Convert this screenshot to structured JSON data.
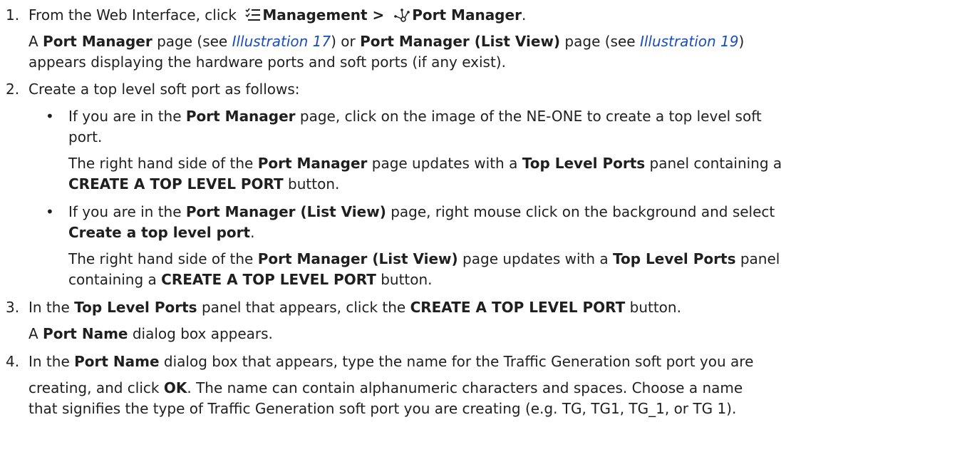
{
  "step1": {
    "num": "1.",
    "intro": "From the Web Interface, click ",
    "menu1": "Management > ",
    "menu2": "Port Manager",
    "end": ".",
    "result": {
      "a": "A ",
      "pm": "Port Manager",
      "see1_pre": " page (see ",
      "ill17": "Illustration 17",
      "see1_post": ") or ",
      "pmlv": "Port Manager (List View)",
      "see2_pre": " page (see ",
      "ill19": "Illustration 19",
      "see2_post": ")",
      "line2": "appears displaying the hardware ports and soft ports (if any exist)."
    }
  },
  "step2": {
    "num": "2.",
    "text": "Create a top level soft port as follows:",
    "bullet1": {
      "dot": "•",
      "pre": "If you are in the ",
      "pm": "Port Manager",
      "post": " page, click on the image of the NE-ONE to create a top level soft",
      "line2": "port.",
      "r_pre": "The right hand side of the ",
      "r_pm": "Port Manager",
      "r_mid": " page updates with a ",
      "r_tlp": "Top Level Ports",
      "r_post": " panel containing a",
      "r_btn": "CREATE A TOP LEVEL PORT",
      "r_end": " button."
    },
    "bullet2": {
      "dot": "•",
      "pre": "If you are in the ",
      "pmlv": "Port Manager (List View)",
      "post": " page, right mouse click on the background and select",
      "cmd": "Create a top level port",
      "cmd_end": ".",
      "r_pre": "The right hand side of the ",
      "r_pmlv": "Port Manager (List View)",
      "r_mid": " page updates with a ",
      "r_tlp": "Top Level Ports",
      "r_post": " panel",
      "r_line2_pre": "containing a ",
      "r_btn": "CREATE A TOP LEVEL PORT",
      "r_end": " button."
    }
  },
  "step3": {
    "num": "3.",
    "pre": "In the ",
    "tlp": "Top Level Ports",
    "mid": " panel that appears, click the ",
    "btn": "CREATE A TOP LEVEL PORT",
    "end": " button.",
    "r_a": "A ",
    "r_pn": "Port Name",
    "r_end": " dialog box appears."
  },
  "step4": {
    "num": "4.",
    "pre": "In the ",
    "pn": "Port Name",
    "post": " dialog box that appears, type the name for the Traffic Generation soft port you are",
    "l2_pre": "creating, and click ",
    "ok": "OK",
    "l2_post": ". The name can contain alphanumeric characters and spaces. Choose a name",
    "l3": "that signifies the type of Traffic Generation soft port you are creating (e.g. TG, TG1, TG_1, or TG 1)."
  },
  "icons": {
    "management": "management-menu-icon",
    "port_manager": "port-manager-icon"
  },
  "colors": {
    "text": "#1f1f1f",
    "link": "#1a4db8"
  }
}
